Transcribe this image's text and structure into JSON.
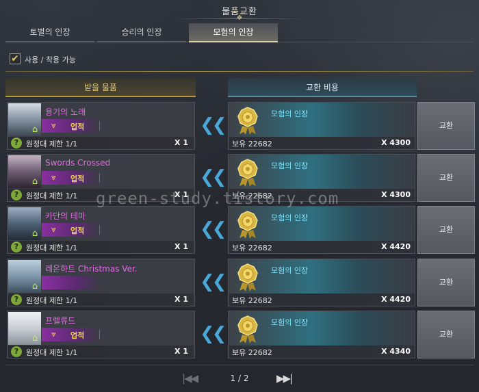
{
  "window": {
    "title": "물품교환"
  },
  "tabs": [
    {
      "label": "토벌의 인장",
      "active": false
    },
    {
      "label": "승리의 인장",
      "active": false
    },
    {
      "label": "모험의 인장",
      "active": true
    }
  ],
  "filter": {
    "label": "사용 / 착용 가능",
    "checked": true
  },
  "columns": {
    "receive": "받을 물품",
    "cost": "교환 비용"
  },
  "rows": [
    {
      "item_name": "용기의 노래",
      "badge": "업적",
      "limit": "원정대 제한 1/1",
      "qty": "X 1",
      "cost_name": "모험의 인장",
      "owned": "보유 22682",
      "cost_qty": "X 4300",
      "button": "교환"
    },
    {
      "item_name": "Swords Crossed",
      "badge": "업적",
      "limit": "원정대 제한 1/1",
      "qty": "X 1",
      "cost_name": "모험의 인장",
      "owned": "보유 22682",
      "cost_qty": "X 4300",
      "button": "교환"
    },
    {
      "item_name": "카단의 테마",
      "badge": "업적",
      "limit": "원정대 제한 1/1",
      "qty": "X 1",
      "cost_name": "모험의 인장",
      "owned": "보유 22682",
      "cost_qty": "X 4420",
      "button": "교환"
    },
    {
      "item_name": "레온하트 Christmas Ver.",
      "badge": "",
      "limit": "원정대 제한 1/1",
      "qty": "X 1",
      "cost_name": "모험의 인장",
      "owned": "보유 22682",
      "cost_qty": "X 4420",
      "button": "교환"
    },
    {
      "item_name": "프렐류드",
      "badge": "업적",
      "limit": "원정대 제한 1/1",
      "qty": "X 1",
      "cost_name": "모험의 인장",
      "owned": "보유 22682",
      "cost_qty": "X 4340",
      "button": "교환"
    }
  ],
  "pagination": {
    "text": "1 / 2"
  },
  "watermark": "green-study.tistory.com",
  "colors": {
    "item_name": "#e06de0",
    "badge": "#f1d257",
    "cost_name": "#7fe6ff",
    "arrow": "#4aa8d8"
  },
  "icons": {
    "medal": "medal-icon",
    "house": "house-icon",
    "help": "help-icon",
    "achievement": "achievement-chevron-icon"
  }
}
